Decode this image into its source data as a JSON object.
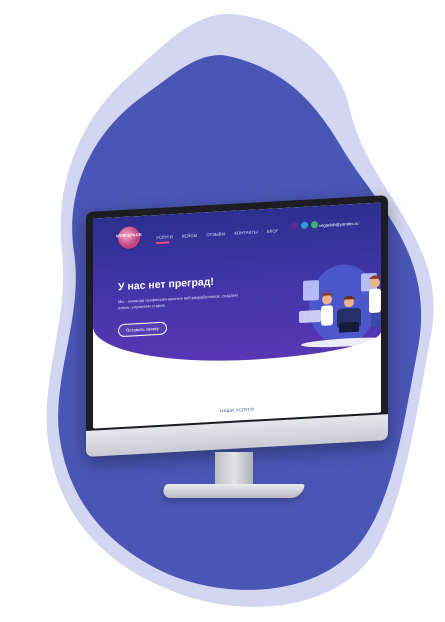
{
  "colors": {
    "blob": "#4a56b5",
    "blob_light": "#aeb4e6",
    "hero_dark": "#2d2f8f",
    "hero_light": "#5936b4",
    "accent_pink": "#e9498f",
    "link_blue": "#3c46b4"
  },
  "site": {
    "logo_text": "WEB SPACE",
    "nav": [
      "Услуги",
      "Кейсы",
      "Отзывы",
      "Контакты",
      "Блог"
    ],
    "social_icons": [
      "whatsapp-icon",
      "telegram-icon",
      "viber-icon"
    ],
    "email": "vegaclub@yandex.ru",
    "hero_title": "У нас нет преград!",
    "hero_subtitle": "Мы - команда профессиональных веб разработчиков, создаем новое, улучшаем старое.",
    "cta_label": "Оставить заявку",
    "bottom_link": "НАШИ УСЛУГИ"
  }
}
